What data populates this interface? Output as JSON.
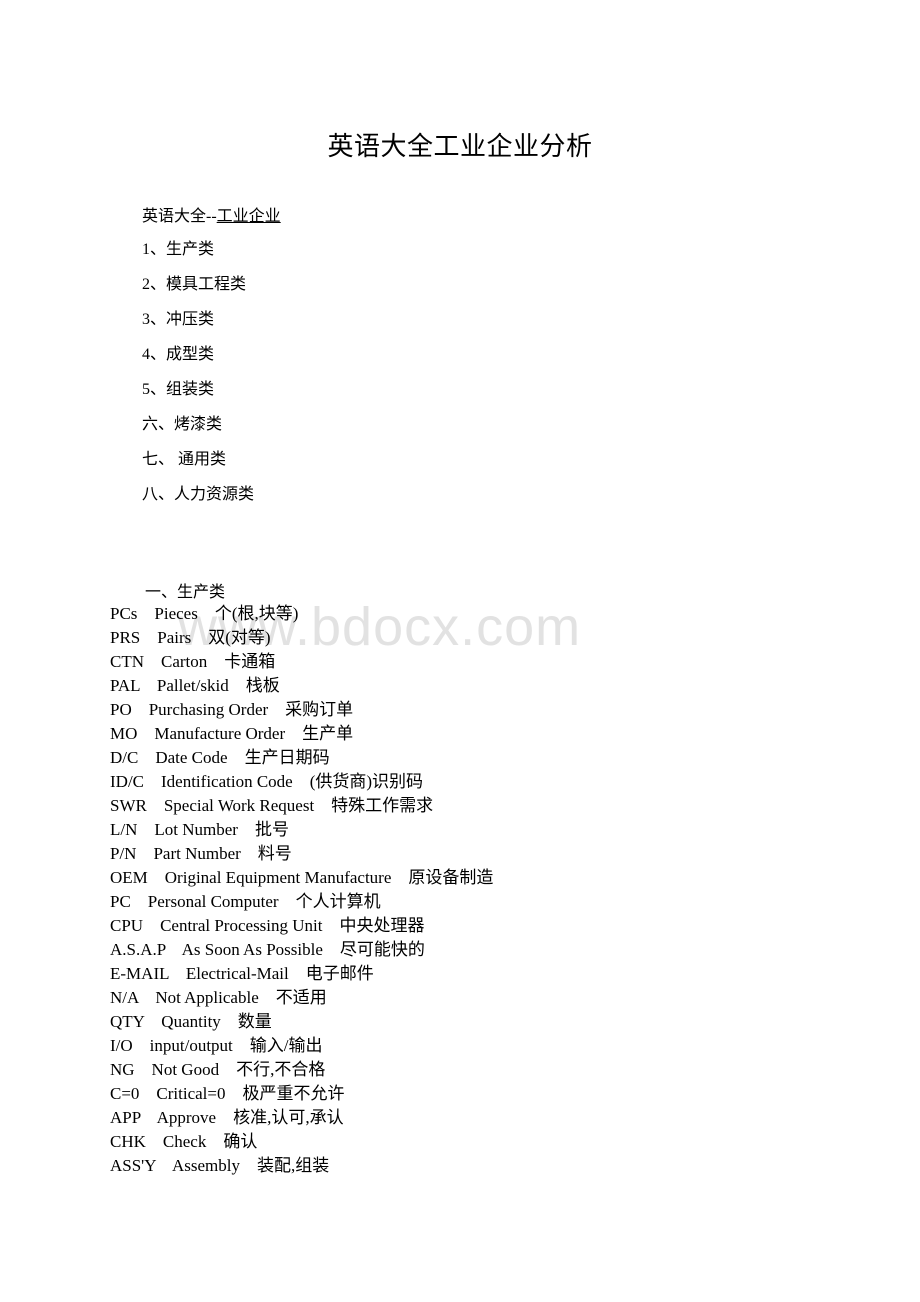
{
  "document": {
    "title": "英语大全工业企业分析",
    "subtitle_prefix": "英语大全--",
    "subtitle_link": "工业企业"
  },
  "watermark": {
    "text": "www.bdocx.com",
    "color": "#e2e2e2"
  },
  "outline": {
    "items": [
      "1、生产类",
      "2、模具工程类",
      "3、冲压类",
      "4、成型类",
      "5、组装类",
      "六、烤漆类",
      "七、 通用类",
      "八、人力资源类"
    ]
  },
  "glossary": {
    "heading": "一、生产类",
    "entries": [
      "PCs    Pieces    个(根,块等)",
      "PRS    Pairs    双(对等)",
      "CTN    Carton    卡通箱",
      "PAL    Pallet/skid    栈板",
      "PO    Purchasing Order    采购订单",
      "MO    Manufacture Order    生产单",
      "D/C    Date Code    生产日期码",
      "ID/C    Identification Code    (供货商)识别码",
      "SWR    Special Work Request    特殊工作需求",
      "L/N    Lot Number    批号",
      "P/N    Part Number    料号",
      "OEM    Original Equipment Manufacture    原设备制造",
      "PC    Personal Computer    个人计算机",
      "CPU    Central Processing Unit    中央处理器",
      "A.S.A.P    As Soon As Possible    尽可能快的",
      "E-MAIL    Electrical-Mail    电子邮件",
      "N/A    Not Applicable    不适用",
      "QTY    Quantity    数量",
      "I/O    input/output    输入/输出",
      "NG    Not Good    不行,不合格",
      "C=0    Critical=0    极严重不允许",
      "APP    Approve    核准,认可,承认",
      "CHK    Check    确认",
      "ASS'Y    Assembly    装配,组装"
    ]
  }
}
